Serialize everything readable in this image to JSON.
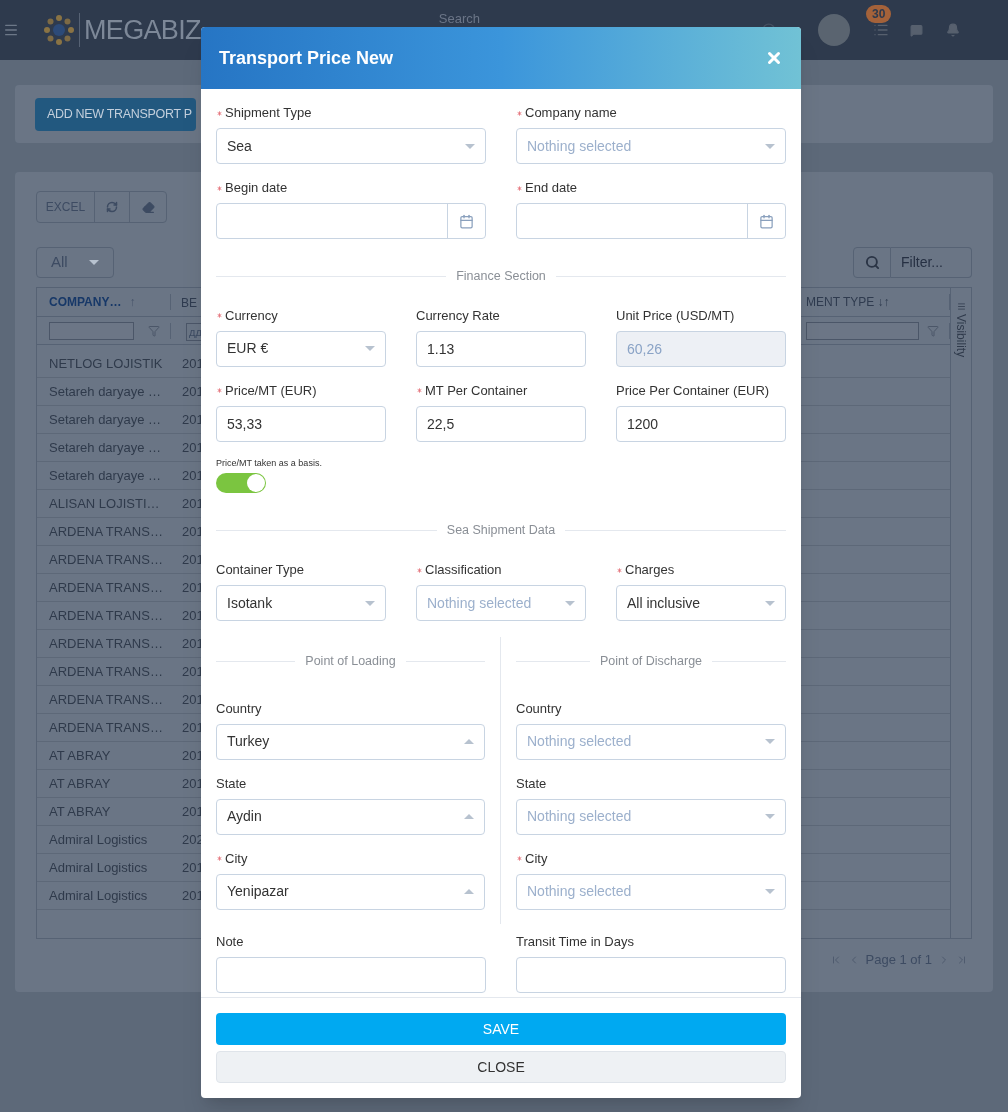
{
  "header": {
    "logo": "MEGABIZ",
    "search_placeholder": "Search",
    "badge": "30"
  },
  "page": {
    "add_button": "ADD NEW TRANSPORT P",
    "excel_button": "EXCEL",
    "view_select": "All",
    "filter_placeholder": "Filter...",
    "table": {
      "columns": [
        {
          "label": "COMPANY…",
          "sort_icon": "↑",
          "sorted": true
        },
        {
          "label": "BE",
          "sorted": false
        },
        {
          "label": "MENT TYPE ↓↑",
          "sorted": false
        }
      ],
      "filter_date_placeholder": "дд",
      "rows": [
        {
          "company": "NETLOG LOJISTIK",
          "year": "201"
        },
        {
          "company": "Setareh daryaye …",
          "year": "201"
        },
        {
          "company": "Setareh daryaye …",
          "year": "201"
        },
        {
          "company": "Setareh daryaye …",
          "year": "201"
        },
        {
          "company": "Setareh daryaye …",
          "year": "201"
        },
        {
          "company": "ALISAN LOJISTI…",
          "year": "201"
        },
        {
          "company": "ARDENA TRANS…",
          "year": "201"
        },
        {
          "company": "ARDENA TRANS…",
          "year": "201"
        },
        {
          "company": "ARDENA TRANS…",
          "year": "201"
        },
        {
          "company": "ARDENA TRANS…",
          "year": "201"
        },
        {
          "company": "ARDENA TRANS…",
          "year": "201"
        },
        {
          "company": "ARDENA TRANS…",
          "year": "201"
        },
        {
          "company": "ARDENA TRANS…",
          "year": "201"
        },
        {
          "company": "ARDENA TRANS…",
          "year": "201"
        },
        {
          "company": "AT ABRAY",
          "year": "201"
        },
        {
          "company": "AT ABRAY",
          "year": "201"
        },
        {
          "company": "AT ABRAY",
          "year": "201"
        },
        {
          "company": "Admiral Logistics",
          "year": "202"
        },
        {
          "company": "Admiral Logistics",
          "year": "201"
        },
        {
          "company": "Admiral Logistics",
          "year": "201"
        }
      ],
      "visibility": "Visibility",
      "pager": "Page 1 of 1"
    }
  },
  "modal": {
    "title": "Transport Price New",
    "sections": [
      {
        "kind": "pair",
        "fields": [
          {
            "label": "Shipment Type",
            "required": true,
            "kind": "select",
            "value": "Sea",
            "expanded": false
          },
          {
            "label": "Company name",
            "required": true,
            "kind": "select",
            "placeholder": "Nothing selected",
            "expanded": false
          },
          {
            "label": "Begin date",
            "required": true,
            "kind": "date"
          },
          {
            "label": "End date",
            "required": true,
            "kind": "date"
          }
        ]
      },
      {
        "kind": "divider",
        "label": "Finance Section"
      },
      {
        "kind": "triple",
        "fields": [
          {
            "label": "Currency",
            "required": true,
            "kind": "select",
            "value": "EUR €",
            "expanded": false
          },
          {
            "label": "Currency Rate",
            "required": false,
            "kind": "input",
            "value": "1.13"
          },
          {
            "label": "Unit Price (USD/MT)",
            "required": false,
            "kind": "input",
            "value": "60,26",
            "disabled": true
          },
          {
            "label": "Price/MT (EUR)",
            "required": true,
            "kind": "input",
            "value": "53,33"
          },
          {
            "label": "MT Per Container",
            "required": true,
            "kind": "input",
            "value": "22,5"
          },
          {
            "label": "Price Per Container (EUR)",
            "required": false,
            "kind": "input",
            "value": "1200"
          }
        ]
      },
      {
        "kind": "toggle",
        "label": "Price/MT taken as a basis.",
        "on": true
      },
      {
        "kind": "divider",
        "label": "Sea Shipment Data"
      },
      {
        "kind": "triple",
        "fields": [
          {
            "label": "Container Type",
            "required": false,
            "kind": "select",
            "value": "Isotank",
            "expanded": false
          },
          {
            "label": "Classification",
            "required": true,
            "kind": "select",
            "placeholder": "Nothing selected",
            "expanded": false
          },
          {
            "label": "Charges",
            "required": true,
            "kind": "select",
            "value": "All inclusive",
            "expanded": false
          }
        ]
      },
      {
        "kind": "split",
        "columns": [
          {
            "heading": "Point of Loading",
            "fields": [
              {
                "label": "Country",
                "required": false,
                "kind": "select",
                "value": "Turkey",
                "expanded": true
              },
              {
                "label": "State",
                "required": false,
                "kind": "select",
                "value": "Aydin",
                "expanded": true
              },
              {
                "label": "City",
                "required": true,
                "kind": "select",
                "value": "Yenipazar",
                "expanded": true
              }
            ]
          },
          {
            "heading": "Point of Discharge",
            "fields": [
              {
                "label": "Country",
                "required": false,
                "kind": "select",
                "placeholder": "Nothing selected",
                "expanded": false
              },
              {
                "label": "State",
                "required": false,
                "kind": "select",
                "placeholder": "Nothing selected",
                "expanded": false
              },
              {
                "label": "City",
                "required": true,
                "kind": "select",
                "placeholder": "Nothing selected",
                "expanded": false
              }
            ]
          }
        ]
      },
      {
        "kind": "pair",
        "fields": [
          {
            "label": "Note",
            "required": false,
            "kind": "input"
          },
          {
            "label": "Transit Time in Days",
            "required": false,
            "kind": "input"
          }
        ]
      }
    ],
    "save": "SAVE",
    "close": "CLOSE"
  }
}
